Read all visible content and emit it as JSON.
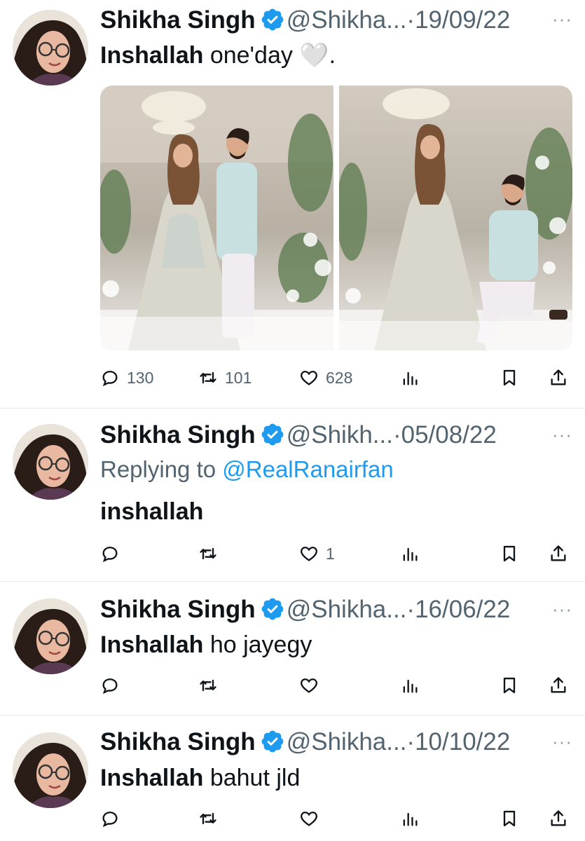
{
  "colors": {
    "verified": "#1d9bf0",
    "text": "#0f1419",
    "muted": "#536471",
    "link": "#1d9bf0",
    "divider": "#e6e9ec"
  },
  "icons": {
    "reply": "reply-icon",
    "retweet": "retweet-icon",
    "like": "heart-icon",
    "views": "views-icon",
    "bookmark": "bookmark-icon",
    "share": "share-icon",
    "more": "more-icon",
    "verified": "verified-badge-icon"
  },
  "tweets": [
    {
      "name": "Shikha Singh",
      "handle": "@Shikha...",
      "sep": "·",
      "date": "19/09/22",
      "more": "···",
      "bold": "Inshallah",
      "text": " one'day 🤍.",
      "reply_prefix": "",
      "reply_to": "",
      "has_media": true,
      "replies": "130",
      "retweets": "101",
      "likes": "628"
    },
    {
      "name": "Shikha Singh",
      "handle": "@Shikh...",
      "sep": "·",
      "date": "05/08/22",
      "more": "···",
      "bold": "inshallah",
      "text": "",
      "reply_prefix": "Replying to ",
      "reply_to": "@RealRanairfan",
      "has_media": false,
      "replies": "",
      "retweets": "",
      "likes": "1"
    },
    {
      "name": "Shikha Singh",
      "handle": "@Shikha...",
      "sep": "·",
      "date": "16/06/22",
      "more": "···",
      "bold": "Inshallah",
      "text": " ho jayegy",
      "reply_prefix": "",
      "reply_to": "",
      "has_media": false,
      "replies": "",
      "retweets": "",
      "likes": ""
    },
    {
      "name": "Shikha Singh",
      "handle": "@Shikha...",
      "sep": "·",
      "date": "10/10/22",
      "more": "···",
      "bold": "Inshallah",
      "text": " bahut jld",
      "reply_prefix": "",
      "reply_to": "",
      "has_media": false,
      "replies": "",
      "retweets": "",
      "likes": ""
    }
  ]
}
